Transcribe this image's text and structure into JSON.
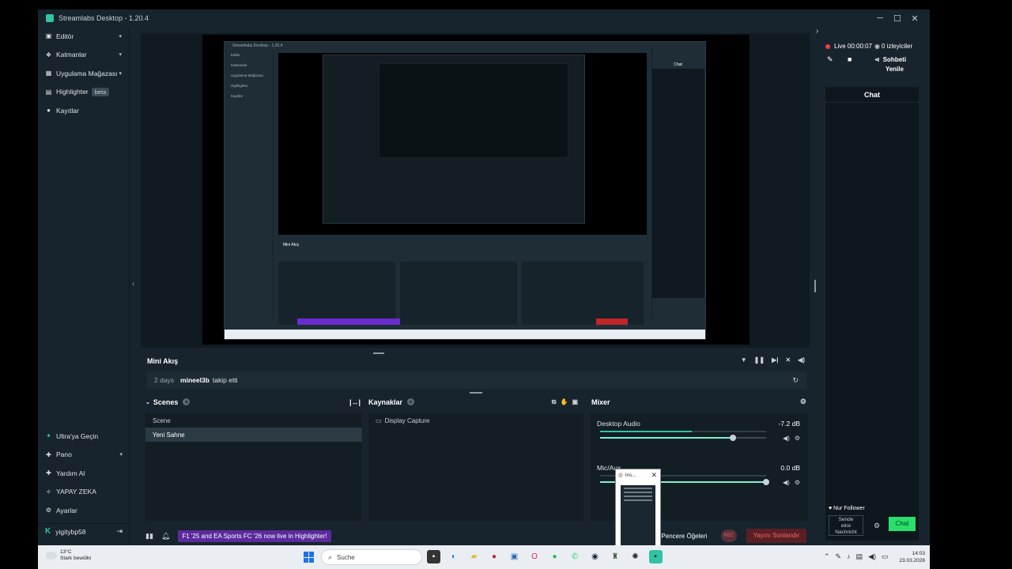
{
  "window": {
    "title": "Streamlabs Desktop - 1.20.4",
    "controls": [
      "─",
      "☐",
      "✕"
    ]
  },
  "sidebar": {
    "items": [
      {
        "label": "Editör",
        "icon": "editor-icon"
      },
      {
        "label": "Katmanlar",
        "icon": "layers-icon"
      },
      {
        "label": "Uygulama Mağazası",
        "icon": "store-icon"
      },
      {
        "label": "Highlighter",
        "badge": "beta",
        "icon": "highlighter-icon"
      },
      {
        "label": "Kayıtlar",
        "icon": "recordings-icon"
      }
    ],
    "bottom_items": [
      {
        "label": "Ultra'ya Geçin",
        "icon": "ultra-icon"
      },
      {
        "label": "Pano",
        "icon": "dashboard-icon"
      },
      {
        "label": "Yardım Al",
        "icon": "help-icon"
      },
      {
        "label": "YAPAY ZEKA",
        "icon": "ai-icon"
      },
      {
        "label": "Ayarlar",
        "icon": "settings-icon"
      }
    ],
    "username": "yigitybp58"
  },
  "mini_feed": {
    "title": "Mini Akış",
    "event": {
      "time": "2 days",
      "user": "mineel3b",
      "action": "takip etti"
    }
  },
  "scenes": {
    "title": "Scenes",
    "header": "Scene",
    "items": [
      "Yeni Sahne"
    ]
  },
  "sources": {
    "title": "Kaynaklar",
    "items": [
      "Display Capture"
    ]
  },
  "mixer": {
    "title": "Mixer",
    "channels": [
      {
        "name": "Desktop Audio",
        "db": "-7.2 dB",
        "level": 0.55,
        "volume": 0.8
      },
      {
        "name": "Mic/Aux",
        "db": "0.0 dB",
        "level": 0.0,
        "volume": 1.0
      }
    ]
  },
  "footer": {
    "promo": "F1 '25 and EA Sports FC '26 now live in Highlighter!",
    "source_windows": "st Pencere Öğeleri",
    "rec_label": "REC",
    "end_stream": "Yayını Sonlandır"
  },
  "popup": {
    "title": "Ins..."
  },
  "right_panel": {
    "live_time": "Live 00:00:07",
    "viewers": "0 izleyiciler",
    "refresh_chat_line1": "Sohbeti",
    "refresh_chat_line2": "Yenile",
    "chat_title": "Chat",
    "follower_event": "Nur Follower",
    "input_placeholder_l1": "Sende",
    "input_placeholder_l2": "eine",
    "input_placeholder_l3": "Nachricht",
    "send_label": "Chat"
  },
  "preview_inner": {
    "title": "Streamlabs Desktop - 1.20.4",
    "nav": [
      "Editör",
      "Katmanlar",
      "Uygulama Mağazası",
      "Highlighter",
      "Kayıtlar"
    ],
    "mini": "Mini Akış",
    "chat": "Chat"
  },
  "taskbar": {
    "weather_temp": "13°C",
    "weather_desc": "Stark bewölkt",
    "search": "Suche",
    "time": "14:03",
    "date": "23.03.2026"
  }
}
